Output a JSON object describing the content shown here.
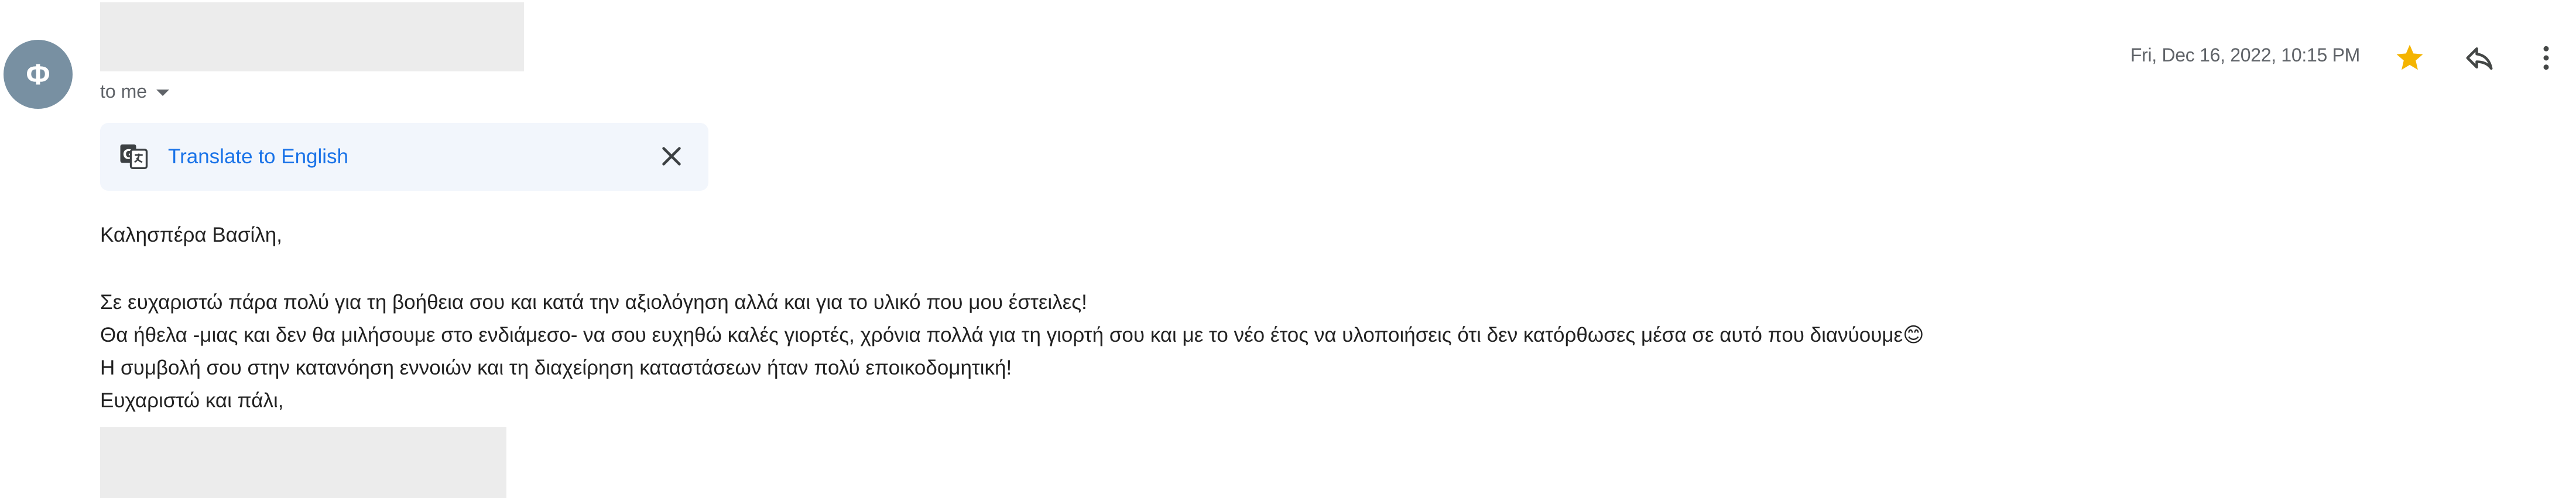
{
  "sender": {
    "avatar_letter": "Φ",
    "avatar_color": "#7890a2",
    "recipient_label": "to me"
  },
  "header": {
    "date": "Fri, Dec 16, 2022, 10:15 PM",
    "star_color": "#f4b400",
    "icons": [
      "star-icon",
      "reply-icon",
      "more-vert-icon"
    ]
  },
  "translate": {
    "link_label": "Translate to English",
    "icon": "translate-icon",
    "close_icon": "close-icon"
  },
  "message": {
    "greeting": "Καλησπέρα Βασίλη,",
    "lines": [
      "Σε ευχαριστώ πάρα πολύ για τη βοήθεια σου και κατά την αξιολόγηση αλλά και για το υλικό που μου έστειλες!",
      "Θα ήθελα -μιας και δεν θα μιλήσουμε στο ενδιάμεσο- να σου ευχηθώ καλές γιορτές, χρόνια πολλά για τη γιορτή σου και με το νέο έτος να υλοποιήσεις ότι δεν κατόρθωσες μέσα σε αυτό που διανύουμε😊",
      "Η συμβολή σου στην κατανόηση εννοιών και τη διαχείρηση καταστάσεων ήταν πολύ εποικοδομητική!",
      "Ευχαριστώ και πάλι,"
    ]
  }
}
